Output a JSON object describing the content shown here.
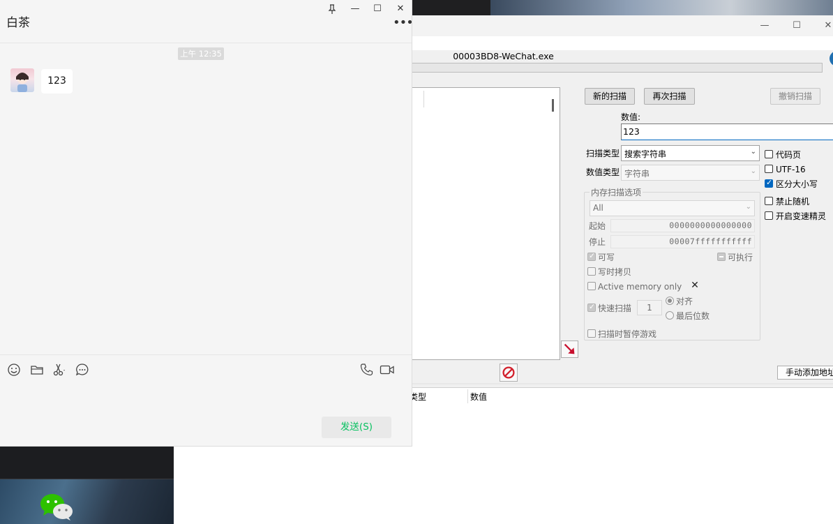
{
  "cheat_engine": {
    "process_title": "00003BD8-WeChat.exe",
    "buttons": {
      "new_scan": "新的扫描",
      "next_scan": "再次扫描",
      "undo_scan": "撤销扫描",
      "add_address_manually": "手动添加地址"
    },
    "value_label": "数值:",
    "value_input": "123",
    "scan_type_label": "扫描类型",
    "scan_type_value": "搜索字符串",
    "value_type_label": "数值类型",
    "value_type_value": "字符串",
    "right_options": {
      "codepage": "代码页",
      "utf16": "UTF-16",
      "case_sensitive": "区分大小写",
      "disable_random": "禁止随机",
      "speedhack": "开启变速精灵"
    },
    "memory_options": {
      "title": "内存扫描选项",
      "region": "All",
      "start_label": "起始",
      "start_value": "0000000000000000",
      "stop_label": "停止",
      "stop_value": "00007fffffffffff",
      "writable": "可写",
      "executable": "可执行",
      "copy_on_write": "写时拷贝",
      "active_memory_only": "Active memory only",
      "fast_scan": "快速扫描",
      "fast_scan_value": "1",
      "alignment": "对齐",
      "last_digits": "最后位数",
      "pause_game": "扫描时暂停游戏"
    },
    "address_list": {
      "col_type": "类型",
      "col_value": "数值"
    },
    "colors": {
      "checkbox_accent": "#0067c0"
    }
  },
  "wechat": {
    "contact_name": "白茶",
    "timestamp": "上午 12:35",
    "message_text": "123",
    "send_button": "发送(S)",
    "colors": {
      "send_text": "#07c160"
    }
  }
}
